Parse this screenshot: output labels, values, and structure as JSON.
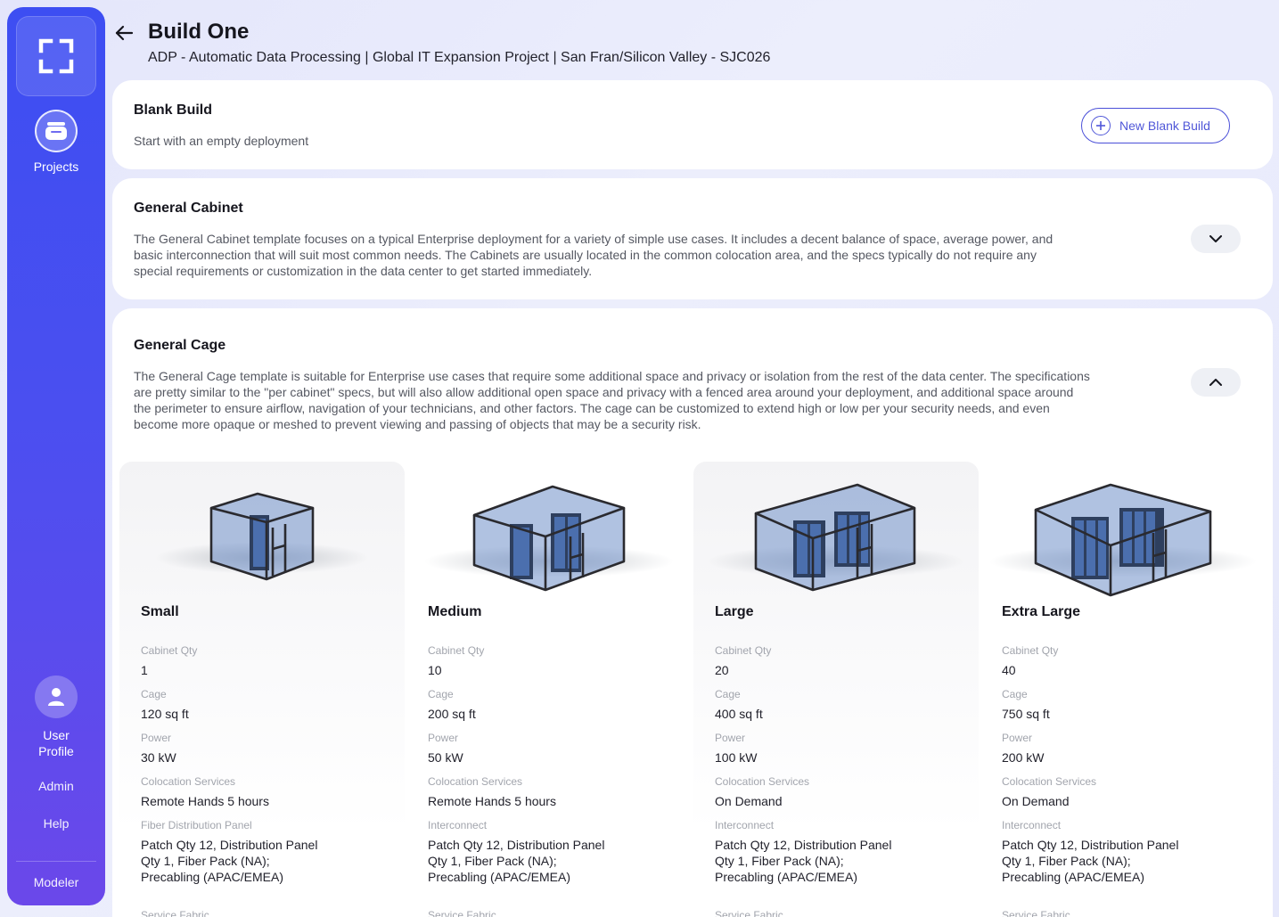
{
  "sidebar": {
    "nav_projects": "Projects",
    "nav_user_profile": "User Profile",
    "nav_admin": "Admin",
    "nav_help": "Help",
    "nav_modeler": "Modeler"
  },
  "header": {
    "title": "Build One",
    "subtitle": "ADP - Automatic Data Processing | Global IT Expansion Project | San Fran/Silicon Valley - SJC026"
  },
  "blank_build": {
    "title": "Blank Build",
    "description": "Start with an empty deployment",
    "button_label": "New Blank Build"
  },
  "general_cabinet": {
    "title": "General Cabinet",
    "description": "The General Cabinet template focuses on a typical Enterprise deployment for a variety of simple use cases.  It includes a decent balance of space, average power, and basic interconnection that will suit most common needs.  The Cabinets are usually located in the common colocation area, and the specs typically do not require any special requirements or customization in the data center to get started immediately."
  },
  "general_cage": {
    "title": "General Cage",
    "description": "The General Cage template is suitable for Enterprise use cases that require some additional space and privacy or isolation from the rest of the data center.  The specifications are pretty similar to the \"per cabinet\" specs, but will also allow additional open space and privacy with a fenced area around your deployment, and additional space around the perimeter to ensure airflow, navigation of your technicians, and other factors.  The cage can be customized to extend high or low per your security needs, and even become more opaque or meshed to prevent viewing and passing of objects that may be a security risk.",
    "sizes": [
      {
        "name": "Small",
        "specs": [
          {
            "label": "Cabinet Qty",
            "value": "1"
          },
          {
            "label": "Cage",
            "value": "120 sq ft"
          },
          {
            "label": "Power",
            "value": "30 kW"
          },
          {
            "label": "Colocation Services",
            "value": "Remote Hands 5 hours"
          },
          {
            "label": "Fiber Distribution Panel",
            "value": "Patch Qty 12, Distribution Panel Qty 1, Fiber Pack (NA); Precabling (APAC/EMEA)"
          },
          {
            "label": "Service Fabric",
            "value": ""
          }
        ]
      },
      {
        "name": "Medium",
        "specs": [
          {
            "label": "Cabinet Qty",
            "value": "10"
          },
          {
            "label": "Cage",
            "value": "200 sq ft"
          },
          {
            "label": "Power",
            "value": "50 kW"
          },
          {
            "label": "Colocation Services",
            "value": "Remote Hands 5 hours"
          },
          {
            "label": "Interconnect",
            "value": "Patch Qty 12, Distribution Panel Qty 1, Fiber Pack (NA); Precabling (APAC/EMEA)"
          },
          {
            "label": "Service Fabric",
            "value": ""
          }
        ]
      },
      {
        "name": "Large",
        "specs": [
          {
            "label": "Cabinet Qty",
            "value": "20"
          },
          {
            "label": "Cage",
            "value": "400 sq ft"
          },
          {
            "label": "Power",
            "value": "100 kW"
          },
          {
            "label": "Colocation Services",
            "value": "On Demand"
          },
          {
            "label": "Interconnect",
            "value": "Patch Qty 12, Distribution Panel Qty 1, Fiber Pack (NA); Precabling (APAC/EMEA)"
          },
          {
            "label": "Service Fabric",
            "value": ""
          }
        ]
      },
      {
        "name": "Extra Large",
        "specs": [
          {
            "label": "Cabinet Qty",
            "value": "40"
          },
          {
            "label": "Cage",
            "value": "750 sq ft"
          },
          {
            "label": "Power",
            "value": "200 kW"
          },
          {
            "label": "Colocation Services",
            "value": "On Demand"
          },
          {
            "label": "Interconnect",
            "value": "Patch Qty 12, Distribution Panel Qty 1, Fiber Pack (NA); Precabling (APAC/EMEA)"
          },
          {
            "label": "Service Fabric",
            "value": ""
          }
        ]
      }
    ]
  },
  "colors": {
    "sidebar_top": "#3d4ef2",
    "sidebar_bottom": "#6b48ea",
    "accent": "#5057d8",
    "cage_glass": "#6f8fc8"
  },
  "icons": {
    "logo": "frame-corners-icon",
    "projects": "stack-icon",
    "user": "user-icon",
    "back": "arrow-left-icon",
    "add": "plus-circle-icon",
    "collapse": "chevron-up-icon",
    "expand": "chevron-down-icon"
  }
}
